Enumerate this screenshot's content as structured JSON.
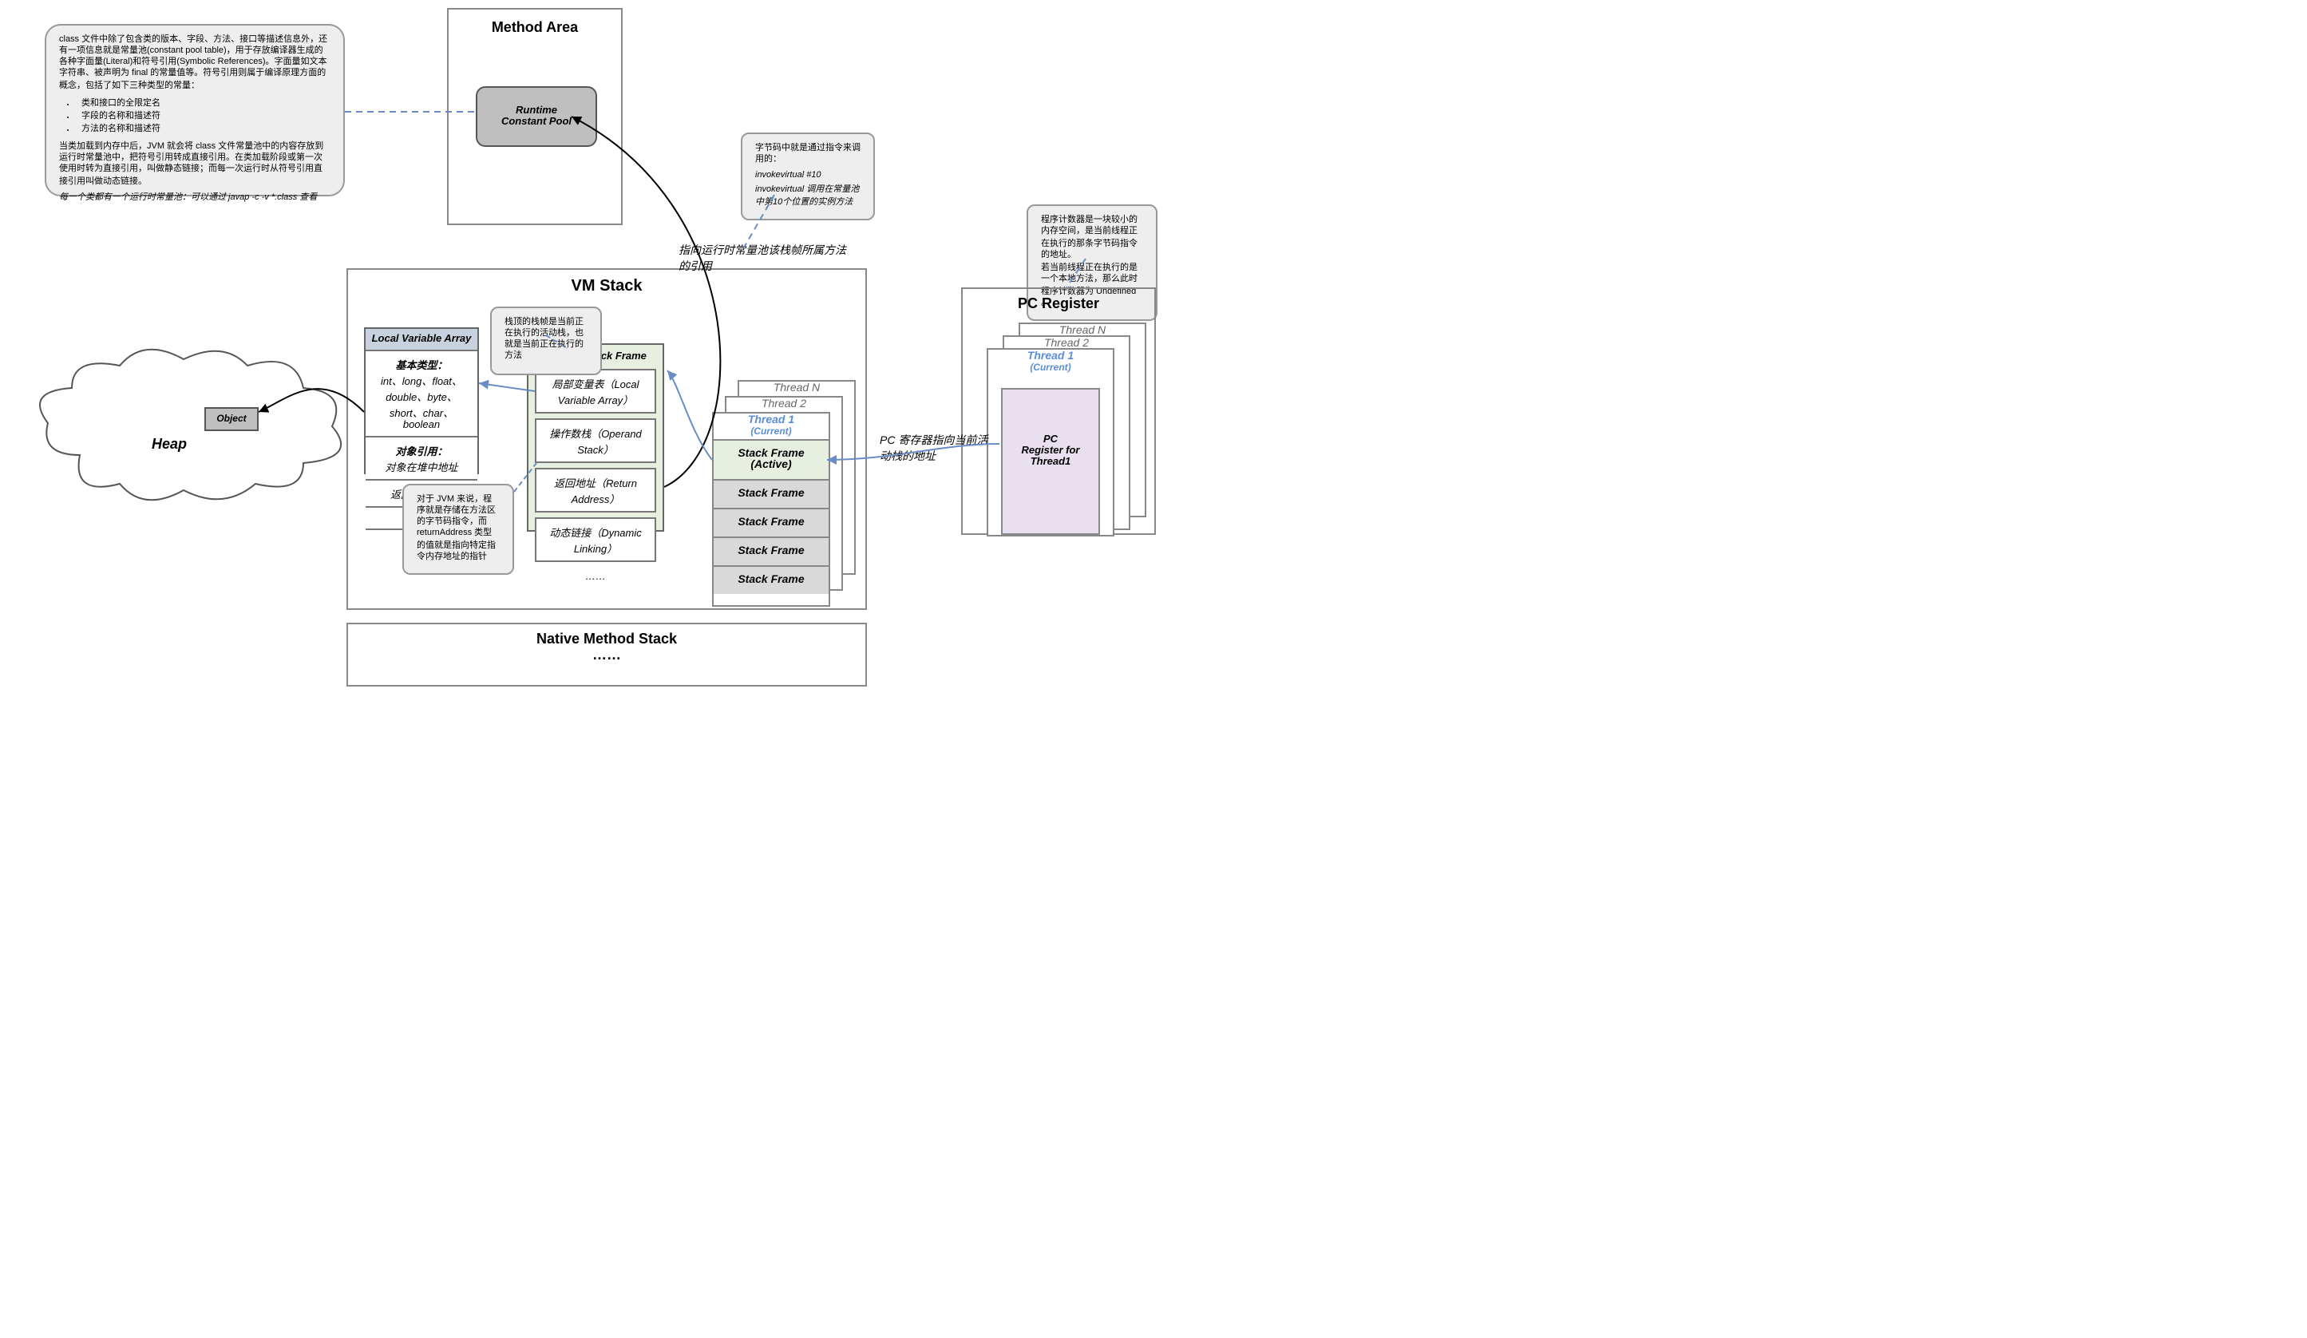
{
  "method_area": {
    "title": "Method Area",
    "pool": "Runtime\nConstant Pool"
  },
  "note_classfile": {
    "p1": "class 文件中除了包含类的版本、字段、方法、接口等描述信息外，还有一项信息就是常量池(constant pool table)，用于存放编译器生成的各种字面量(Literal)和符号引用(Symbolic References)。字面量如文本字符串、被声明为 final 的常量值等。符号引用则属于编译原理方面的概念，包括了如下三种类型的常量：",
    "li1": "类和接口的全限定名",
    "li2": "字段的名称和描述符",
    "li3": "方法的名称和描述符",
    "p2": "当类加载到内存中后，JVM 就会将 class 文件常量池中的内容存放到运行时常量池中，把符号引用转成直接引用。在类加载阶段或第一次使用时转为直接引用，叫做静态链接；而每一次运行时从符号引用直接引用叫做动态链接。",
    "p3": "每一个类都有一个运行时常量池：可以通过 javap -c -v *.class 查看"
  },
  "note_stacktop": "栈顶的栈帧是当前正在执行的活动栈，也就是当前正在执行的方法",
  "note_return": "对于 JVM 来说，程序就是存储在方法区的字节码指令，而 returnAddress 类型的值就是指向特定指令内存地址的指针",
  "note_invoke": {
    "l1": "字节码中就是通过指令来调用的：",
    "l2": "invokevirtual #10",
    "l3": "invokevirtual  调用在常量池中第10个位置的实例方法"
  },
  "note_pc": {
    "l1": "程序计数器是一块较小的内存空间，是当前线程正在执行的那条字节码指令的地址。",
    "l2": "若当前线程正在执行的是一个本地方法，那么此时程序计数器为 Undefined 。"
  },
  "label_pool": "指向运行时常量池该栈帧所属方法的引用",
  "label_pc": "PC 寄存器指向当前活动栈的地址",
  "vm_stack": {
    "title": "VM Stack",
    "lva_title": "Local Variable Array",
    "lva_r1a": "基本类型：",
    "lva_r1b": "int、long、float、double、byte、short、char、boolean",
    "lva_r2a": "对象引用：",
    "lva_r2b": "对象在堆中地址",
    "lva_r3": "返回地址类型",
    "lva_r4": "……",
    "csf_title": "Current Stack Frame",
    "csf_r1": "局部变量表（Local Variable Array）",
    "csf_r2": "操作数栈（Operand Stack）",
    "csf_r3": "返回地址（Return Address）",
    "csf_r4": "动态链接（Dynamic Linking）",
    "csf_r5": "……",
    "threadN": "Thread N",
    "thread2": "Thread 2",
    "thread1": "Thread 1",
    "current": "(Current)",
    "sf_active": "Stack Frame\n(Active)",
    "sf": "Stack Frame"
  },
  "heap": {
    "title": "Heap",
    "object": "Object"
  },
  "native": {
    "title": "Native Method Stack",
    "dots": "……"
  },
  "pc": {
    "title": "PC Register",
    "threadN": "Thread N",
    "thread2": "Thread 2",
    "thread1": "Thread 1",
    "current": "(Current)",
    "inner": "PC\nRegister for\nThread1"
  }
}
